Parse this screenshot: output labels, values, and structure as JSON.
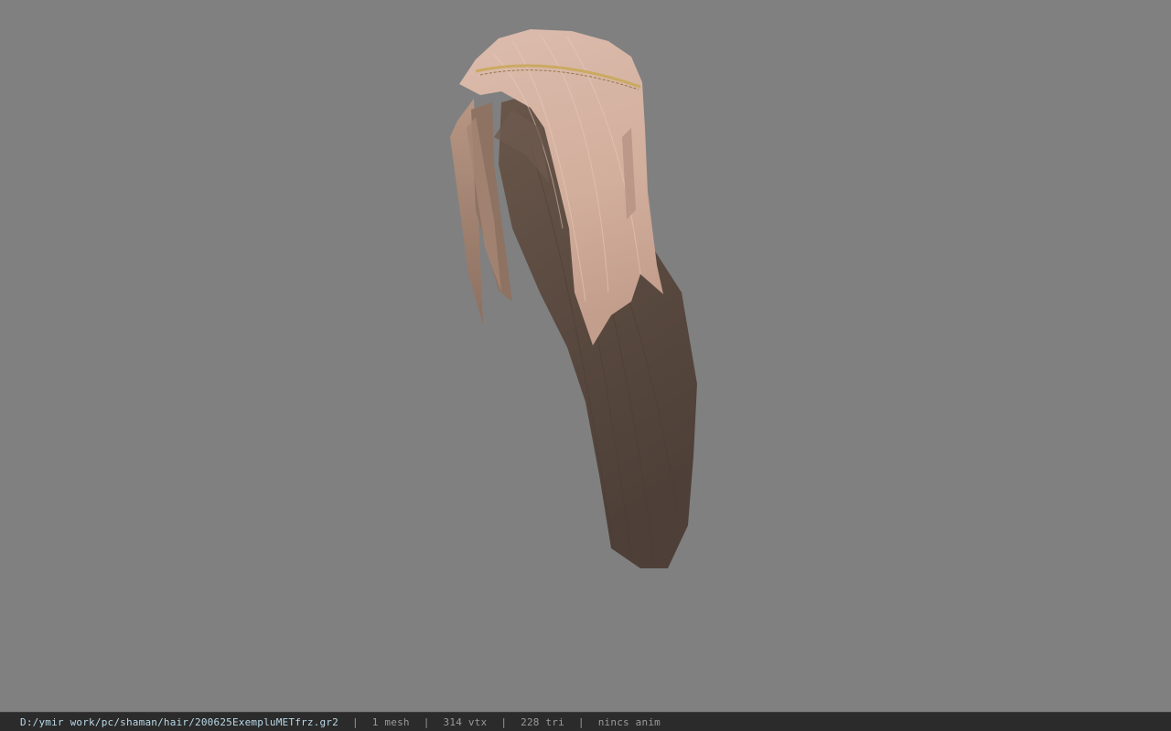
{
  "viewer": {
    "background_color": "#808080",
    "model": {
      "hair_light_color": "#d8b6a6",
      "hair_dark_color": "#5c4c42",
      "circlet_color": "#c9a85a"
    }
  },
  "statusbar": {
    "file_path": "D:/ymir work/pc/shaman/hair/200625ExempluMETfrz.gr2",
    "sep": "|",
    "mesh_count": "1 mesh",
    "vertex_count": "314 vtx",
    "triangle_count": "228 tri",
    "anim_status": "nincs anim"
  }
}
